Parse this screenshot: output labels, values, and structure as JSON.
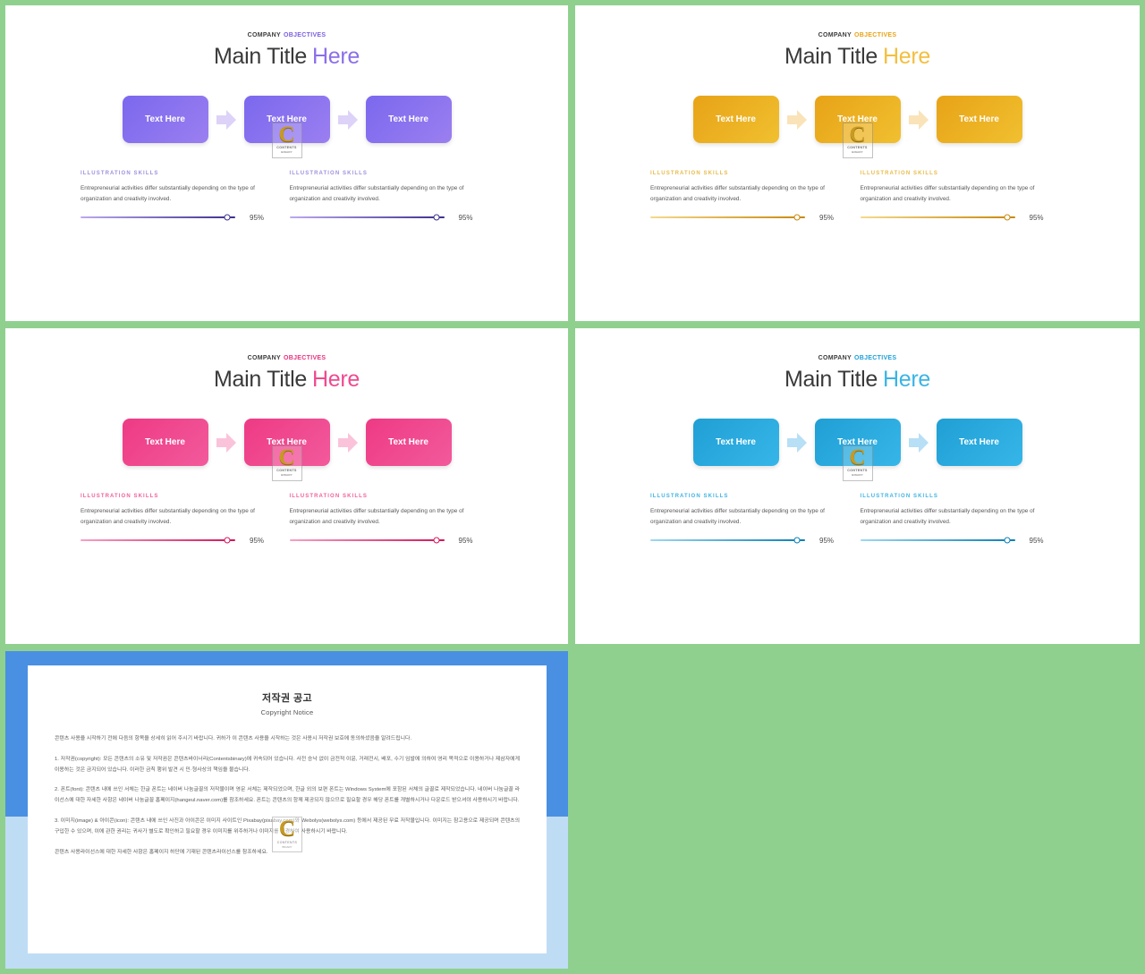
{
  "page": {
    "background_color": "#8fd08f",
    "slide_background": "#ffffff"
  },
  "common": {
    "eyebrow_word1": "COMPANY",
    "eyebrow_word2": "OBJECTIVES",
    "title_main": "Main Title",
    "title_accent": "Here",
    "card_label": "Text Here",
    "skill_label": "ILLUSTRATION SKILLS",
    "skill_desc": "Entrepreneurial activities differ substantially depending on the type of organization and creativity involved.",
    "slider_value": "95%",
    "slider_percent": 95,
    "watermark": {
      "letter": "C",
      "line1": "CONTENTS",
      "line2": "BINARY"
    }
  },
  "slides": [
    {
      "id": "slide-purple",
      "theme_name": "purple",
      "accent": "#8b6fe8",
      "eyebrow_accent": "#7b5fe0",
      "card_gradient_from": "#7b68ee",
      "card_gradient_to": "#9b7ff0",
      "arrow_color": "#ddd2f7",
      "slider_from": "#bda9f0",
      "slider_to": "#3b2f8f",
      "knob_border": "#3b2f8f",
      "skill_label_color": "#a08fdd"
    },
    {
      "id": "slide-orange",
      "theme_name": "orange",
      "accent": "#f3bf3f",
      "eyebrow_accent": "#e8a317",
      "card_gradient_from": "#e8a317",
      "card_gradient_to": "#f0c030",
      "arrow_color": "#fae3b8",
      "slider_from": "#f5d98a",
      "slider_to": "#c8880a",
      "knob_border": "#c8880a",
      "skill_label_color": "#e8bb4a"
    },
    {
      "id": "slide-pink",
      "theme_name": "pink",
      "accent": "#ef4a8f",
      "eyebrow_accent": "#e8337f",
      "card_gradient_from": "#ee3a85",
      "card_gradient_to": "#f25a9c",
      "arrow_color": "#fac3da",
      "slider_from": "#f7a0c6",
      "slider_to": "#d4145a",
      "knob_border": "#d4145a",
      "skill_label_color": "#ef5f9a"
    },
    {
      "id": "slide-blue",
      "theme_name": "blue",
      "accent": "#3bb4e5",
      "eyebrow_accent": "#1ca0d8",
      "card_gradient_from": "#1f9fd4",
      "card_gradient_to": "#36b6e8",
      "arrow_color": "#b7dff5",
      "slider_from": "#9ed8f2",
      "slider_to": "#0a7fb5",
      "knob_border": "#0a7fb5",
      "skill_label_color": "#3fb3e2"
    }
  ],
  "copyright_slide": {
    "frame_color": "#4a90e2",
    "band_color": "#bfdcf5",
    "title_ko": "저작권 공고",
    "title_en": "Copyright Notice",
    "paragraphs": [
      "콘텐츠 사용을 시작하기 전에 다음의 항목을 상세히 읽어 주시기 바랍니다. 귀하가 이 콘텐츠 사용을 시작하는 것은 사용시 저작권 보호에 동의하셨음을 알려드립니다.",
      "1. 저작권(copyright): 모든 콘텐츠의 소유 및 저작권은 콘텐츠바이너리(Contentsbinary)에 귀속되어 있습니다. 사전 승낙 없이 금전적 이윤, 거래전시, 배포, 수기 임발에 의하여 영리 목적으로 이용하거나 제삼자에게 이용하는 것은 금지되어 있습니다. 이러한 금칙 행위 발견 시 민·형사상의 책임을 물습니다.",
      "2. 폰트(font): 콘텐츠 내에 쓰인 서체는 한글 폰트는 네이버 나눔글꼴의 저작물이며 영문 서체는 제작되었으며, 한글 외의 보편 폰트는 Windows System에 포함된 서체의 글꼴로 제작되었습니다. 네이버 나눔글꼴 라이선스에 대한 자세한 사항은 네이버 나눔글꼴 홈페이지(hangeul.naver.com)를 참조하세요. 폰트는 콘텐츠의 함께 제공되지 않으므로 필요할 경우 해당 폰트를 개별하시거나 다운로드 받으셔야 사용하시기 바랍니다.",
      "3. 이미지(image) & 아이콘(icon): 콘텐츠 내에 쓰인 사진과 아이콘은 이미지 사이트인 Pixabay(pixabay.com)와 Webolys(webolys.com) 등에서 제공된 무료 저작물입니다. 이미지는 참고용으로 제공되며 콘텐츠의 구입한 수 있으며, 이에 관한 권리는 귀사가 별도로 확인하고 필요할 경우 이미지를 위주하거나 이미지를 변경하여 사용하시기 바랍니다.",
      "콘텐츠 사용라이선스에 대한 자세한 사항은 홈페이지 하단에 기재된 콘텐츠라이선스를 참조하세요."
    ]
  }
}
